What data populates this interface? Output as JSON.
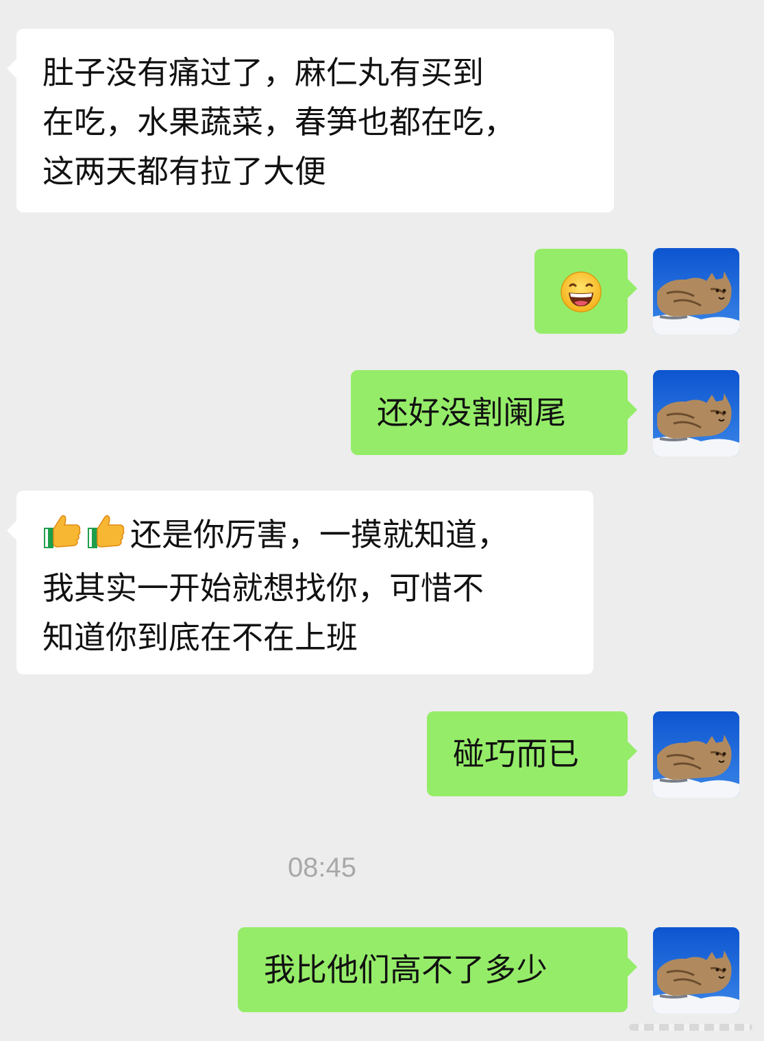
{
  "messages": [
    {
      "direction": "incoming",
      "lines": [
        "肚子没有痛过了，麻仁丸有买到",
        "在吃，水果蔬菜，春笋也都在吃，",
        "这两天都有拉了大便"
      ]
    },
    {
      "direction": "outgoing",
      "emoji": "grinning-face-emoji"
    },
    {
      "direction": "outgoing",
      "text": "还好没割阑尾"
    },
    {
      "direction": "incoming",
      "prefix_emoji": [
        "thumbs-up-emoji",
        "thumbs-up-emoji"
      ],
      "lines": [
        "还是你厉害，一摸就知道，",
        "我其实一开始就想找你，可惜不",
        "知道你到底在不在上班"
      ]
    },
    {
      "direction": "outgoing",
      "text": "碰巧而已"
    },
    {
      "direction": "outgoing",
      "text": "我比他们高不了多少"
    }
  ],
  "timestamp": "08:45",
  "avatar": {
    "icon": "lynx-photo-avatar"
  },
  "colors": {
    "background": "#ededed",
    "incoming_bubble": "#ffffff",
    "outgoing_bubble": "#95ec69",
    "timestamp_text": "#a8a8a8"
  }
}
